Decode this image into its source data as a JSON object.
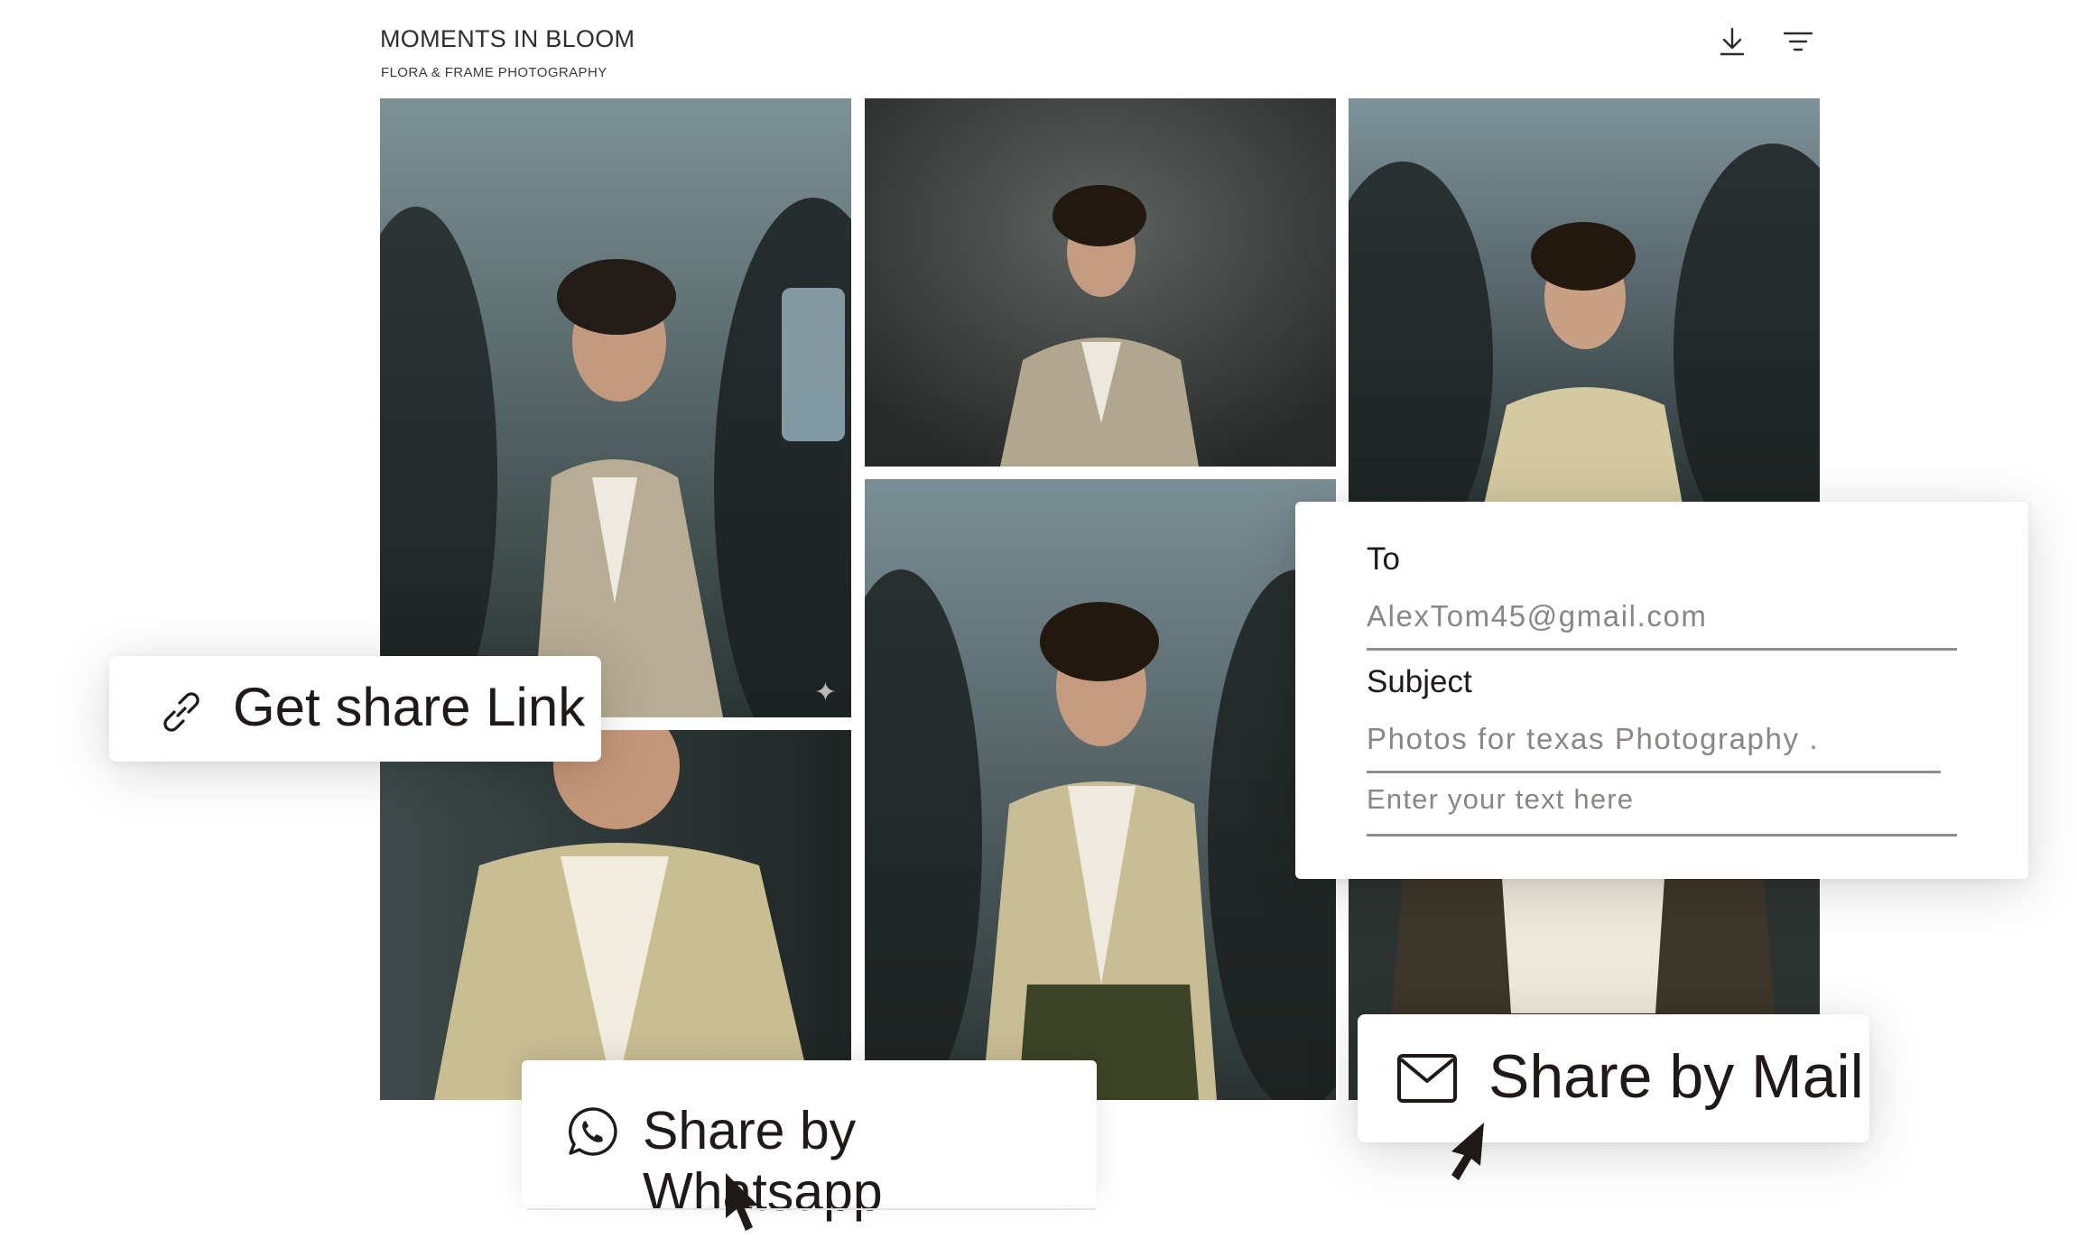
{
  "header": {
    "title": "MOMENTS IN BLOOM",
    "subtitle": "FLORA & FRAME PHOTOGRAPHY",
    "icons": [
      "download-icon",
      "filter-icon"
    ]
  },
  "gallery": {
    "photos": [
      {
        "name": "photo-woman-crowd-left"
      },
      {
        "name": "photo-woman-studio"
      },
      {
        "name": "photo-woman-crowd-right"
      },
      {
        "name": "photo-woman-closeup"
      },
      {
        "name": "photo-woman-center"
      },
      {
        "name": "photo-woman-hands-hips"
      }
    ],
    "sparkle_icon": "sparkle-icon"
  },
  "share_link": {
    "label": "Get share Link",
    "icon": "link-icon"
  },
  "mail_form": {
    "to_label": "To",
    "to_value": "AlexTom45@gmail.com",
    "subject_label": "Subject",
    "subject_value": "Photos for texas Photography .",
    "body_placeholder": "Enter your text here"
  },
  "share_whatsapp": {
    "label": "Share by Whatsapp",
    "icon": "whatsapp-icon"
  },
  "share_mail": {
    "label": "Share by Mail",
    "icon": "mail-icon"
  },
  "colors": {
    "text": "#1f1a17",
    "muted": "#8a8683",
    "photo_bg": "#2a3232"
  }
}
